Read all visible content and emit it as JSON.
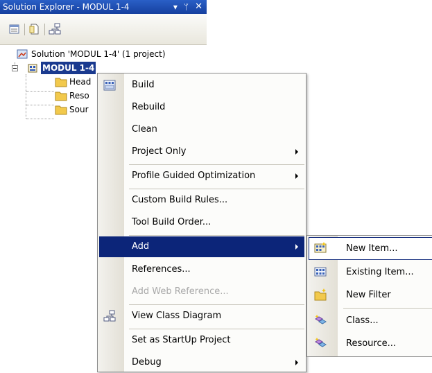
{
  "window": {
    "title": "Solution Explorer - MODUL 1-4",
    "dropdown_glyph": "▾",
    "pin_glyph": "ᛘ",
    "close_glyph": "✕"
  },
  "toolbar": {
    "buttons": [
      "properties-icon",
      "show-all-files-icon",
      "view-class-diagram-icon"
    ]
  },
  "tree": {
    "solution_label": "Solution 'MODUL 1-4' (1 project)",
    "project_label": "MODUL 1-4",
    "folders": [
      "Head",
      "Reso",
      "Sour"
    ]
  },
  "context_menu": {
    "items": [
      {
        "label": "Build",
        "icon": "build-icon"
      },
      {
        "label": "Rebuild"
      },
      {
        "label": "Clean"
      },
      {
        "label": "Project Only",
        "submenu": true
      },
      {
        "label": "Profile Guided Optimization",
        "submenu": true
      },
      {
        "label": "Custom Build Rules..."
      },
      {
        "label": "Tool Build Order..."
      },
      {
        "label": "Add",
        "submenu": true,
        "highlighted": true
      },
      {
        "label": "References..."
      },
      {
        "label": "Add Web Reference...",
        "disabled": true
      },
      {
        "label": "View Class Diagram",
        "icon": "class-diagram-icon"
      },
      {
        "label": "Set as StartUp Project"
      },
      {
        "label": "Debug",
        "submenu": true
      }
    ]
  },
  "add_submenu": {
    "items": [
      {
        "label": "New Item...",
        "icon": "new-item-icon"
      },
      {
        "label": "Existing Item...",
        "icon": "existing-item-icon"
      },
      {
        "label": "New Filter",
        "icon": "new-filter-icon"
      },
      {
        "label": "Class...",
        "icon": "class-wizard-icon"
      },
      {
        "label": "Resource...",
        "icon": "resource-icon"
      }
    ]
  },
  "colors": {
    "title_bar": "#1f4fb5",
    "menu_highlight": "#0c2579",
    "disabled_text": "#a9a9a9",
    "folder": "#f2c94c"
  }
}
